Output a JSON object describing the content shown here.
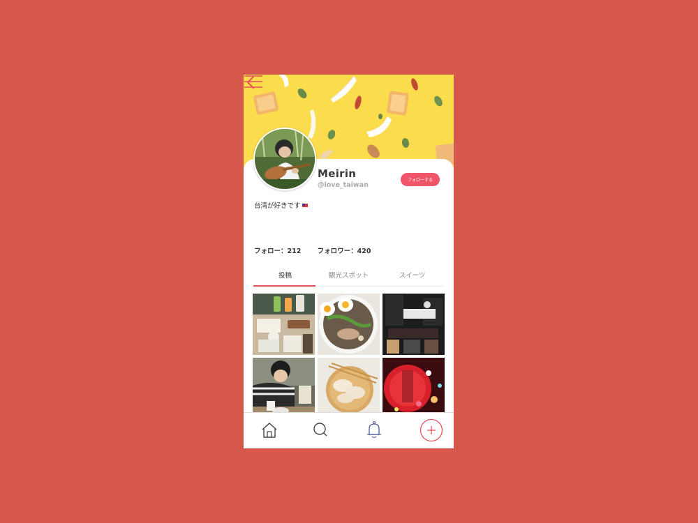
{
  "profile": {
    "name": "Meirin",
    "handle": "@love_taiwan",
    "follow_label": "フォローする",
    "bio": "台湾が好きです",
    "following": "フォロー：212",
    "followers": "フォロワー：420"
  },
  "tabs": [
    {
      "label": "投稿",
      "active": true
    },
    {
      "label": "観光スポット",
      "active": false
    },
    {
      "label": "スイーツ",
      "active": false
    }
  ],
  "header": {
    "back_icon": "chevron-left-icon",
    "menu_icon": "hamburger-menu-icon"
  },
  "posts": [
    "breakfast-table-photo",
    "ramen-bowl-photo",
    "night-street-photo",
    "tea-drinking-photo",
    "dumplings-photo",
    "red-lantern-photo"
  ],
  "bottom_nav": [
    {
      "name": "home-icon"
    },
    {
      "name": "search-icon"
    },
    {
      "name": "bell-icon"
    },
    {
      "name": "add-post-icon"
    }
  ],
  "colors": {
    "background": "#d6584d",
    "accent": "#f0556a",
    "cover": "#fbdc4c"
  }
}
